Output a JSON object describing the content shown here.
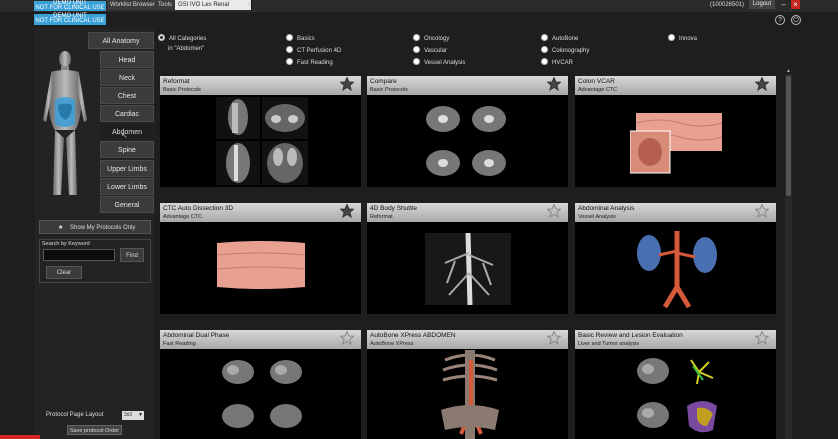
{
  "topbar": {
    "demo1_line1": "DEMO UNIT",
    "demo1_line2": "NOT FOR CLINICAL USE",
    "demo2_line1": "DEMO UNIT",
    "demo2_line2": "NOT FOR CLINICAL USE",
    "tabs": [
      "Worklist Browser",
      "Tools",
      "GSI IVO Les Renal 88541."
    ],
    "tab_close": "×",
    "user_id": "(100026501)",
    "logout_label": "Logout",
    "minimize": "–",
    "close": "×"
  },
  "toolbar": {
    "help_icon": "?",
    "power_icon": "⏻"
  },
  "anatomy": {
    "items": [
      "All Anatomy",
      "Head",
      "Neck",
      "Chest",
      "Cardiac",
      "Abdomen",
      "Spine",
      "Upper Limbs",
      "Lower Limbs",
      "General"
    ],
    "selected": "Abdomen"
  },
  "left": {
    "show_my_label": "Show My Protocols Only",
    "search_label": "Search by Keyword",
    "search_value": "",
    "find_label": "Find",
    "clear_label": "Clear",
    "layout_label": "Protocol Page Layout",
    "layout_value": "3x3",
    "save_order_label": "Save protocol Order"
  },
  "filters": {
    "items": [
      {
        "label": "All Categories",
        "on": true
      },
      {
        "label": "Basics",
        "on": false
      },
      {
        "label": "Oncology",
        "on": false
      },
      {
        "label": "AutoBone",
        "on": false
      },
      {
        "label": "Innova",
        "on": false
      },
      {
        "label": "CT Perfusion 4D",
        "on": false
      },
      {
        "label": "Vascular",
        "on": false
      },
      {
        "label": "Colonography",
        "on": false
      },
      {
        "label": "Fast Reading",
        "on": false
      },
      {
        "label": "Vessel Analysis",
        "on": false
      },
      {
        "label": "HVCAR",
        "on": false
      }
    ],
    "context": "in \"Abdomen\""
  },
  "cards": [
    {
      "title": "Reformat",
      "subtitle": "Basic Protocols",
      "favorite": true
    },
    {
      "title": "Compare",
      "subtitle": "Basic Protocols",
      "favorite": true
    },
    {
      "title": "Colon VCAR",
      "subtitle": "Advantage CTC",
      "favorite": true
    },
    {
      "title": "CTC Auto Dissection 3D",
      "subtitle": "Advantage CTC",
      "favorite": true
    },
    {
      "title": "4D Body Shuttle",
      "subtitle": "Reformat",
      "favorite": false
    },
    {
      "title": "Abdominal Analysis",
      "subtitle": "Vessel Analysis",
      "favorite": false
    },
    {
      "title": "Abdominal Dual Phase",
      "subtitle": "Fast Reading",
      "favorite": false
    },
    {
      "title": "AutoBone XPress ABDOMEN",
      "subtitle": "AutoBone XPress",
      "favorite": false
    },
    {
      "title": "Basic Review and Lesion Evaluation",
      "subtitle": "Liver and Tumor analysis",
      "favorite": false
    }
  ],
  "colors": {
    "demo_blue": "#3aa0d8",
    "header_gray": "#c8c8c8",
    "close_red": "#c3261f",
    "colon_pink": "#e8a090"
  }
}
